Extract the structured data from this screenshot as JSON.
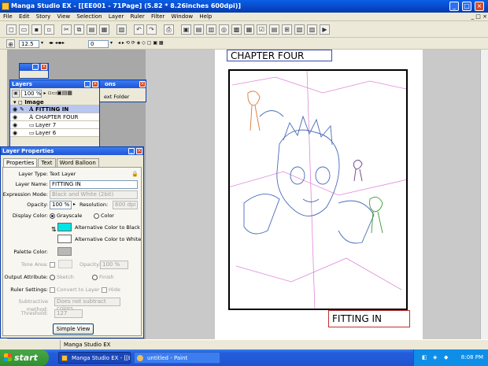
{
  "window": {
    "title": "Manga Studio EX - [[EE001 - 71Page] (5.82 * 8.26inches 600dpi)]"
  },
  "menu": [
    "File",
    "Edit",
    "Story",
    "View",
    "Selection",
    "Layer",
    "Ruler",
    "Filter",
    "Window",
    "Help"
  ],
  "toolbar2": {
    "zoom": "12.5",
    "rotation": "0"
  },
  "canvas": {
    "chapter_text": "CHAPTER FOUR",
    "caption_text": "FITTING IN"
  },
  "layers_palette": {
    "title": "Layers",
    "opacity": "100 %",
    "folder_name": "Image",
    "rows": [
      {
        "name": "FITTING IN",
        "type": "A",
        "selected": true
      },
      {
        "name": "CHAPTER FOUR",
        "type": "A",
        "selected": false
      },
      {
        "name": "Layer 7",
        "type": "",
        "selected": false
      },
      {
        "name": "Layer 6",
        "type": "",
        "selected": false
      }
    ]
  },
  "hidden_palette": {
    "title_suffix": "ons",
    "text": "ext Folder"
  },
  "layer_properties": {
    "title": "Layer Properties",
    "tabs": [
      "Properties",
      "Text",
      "Word Balloon"
    ],
    "layer_type_label": "Layer Type:",
    "layer_type_value": "Text Layer",
    "layer_name_label": "Layer Name:",
    "layer_name_value": "FITTING IN",
    "expression_label": "Expression Mode:",
    "expression_value": "Black and White (2bit)",
    "opacity_label": "Opacity:",
    "opacity_value": "100 %",
    "resolution_label": "Resolution:",
    "resolution_value": "600 dpi",
    "display_color_label": "Display Color:",
    "grayscale_label": "Grayscale",
    "color_label": "Color",
    "alt_black_label": "Alternative Color to Black",
    "alt_white_label": "Alternative Color to White",
    "palette_color_label": "Palette Color:",
    "tone_area_label": "Tone Area:",
    "opacity2_label": "Opacity:",
    "opacity2_value": "100 %",
    "output_label": "Output Attribute:",
    "sketch_label": "Sketch",
    "finish_label": "Finish",
    "ruler_label": "Ruler Settings:",
    "convert_label": "Convert to Layer",
    "hide_label": "Hide",
    "subtractive_label": "Subtractive method:",
    "subtractive_value": "Does not subtract colors",
    "threshold_label": "Threshold:",
    "threshold_value": "127",
    "simple_view_label": "Simple View",
    "colors": {
      "alt_black": "#00e5e5",
      "alt_white": "#ffffff",
      "palette": "#b8b8b8"
    }
  },
  "status": {
    "text": "Manga Studio EX"
  },
  "taskbar": {
    "start_label": "start",
    "tasks": [
      {
        "label": "Manga Studio EX - [[E..."
      },
      {
        "label": "untitled - Paint"
      }
    ],
    "clock": "8:08 PM"
  }
}
